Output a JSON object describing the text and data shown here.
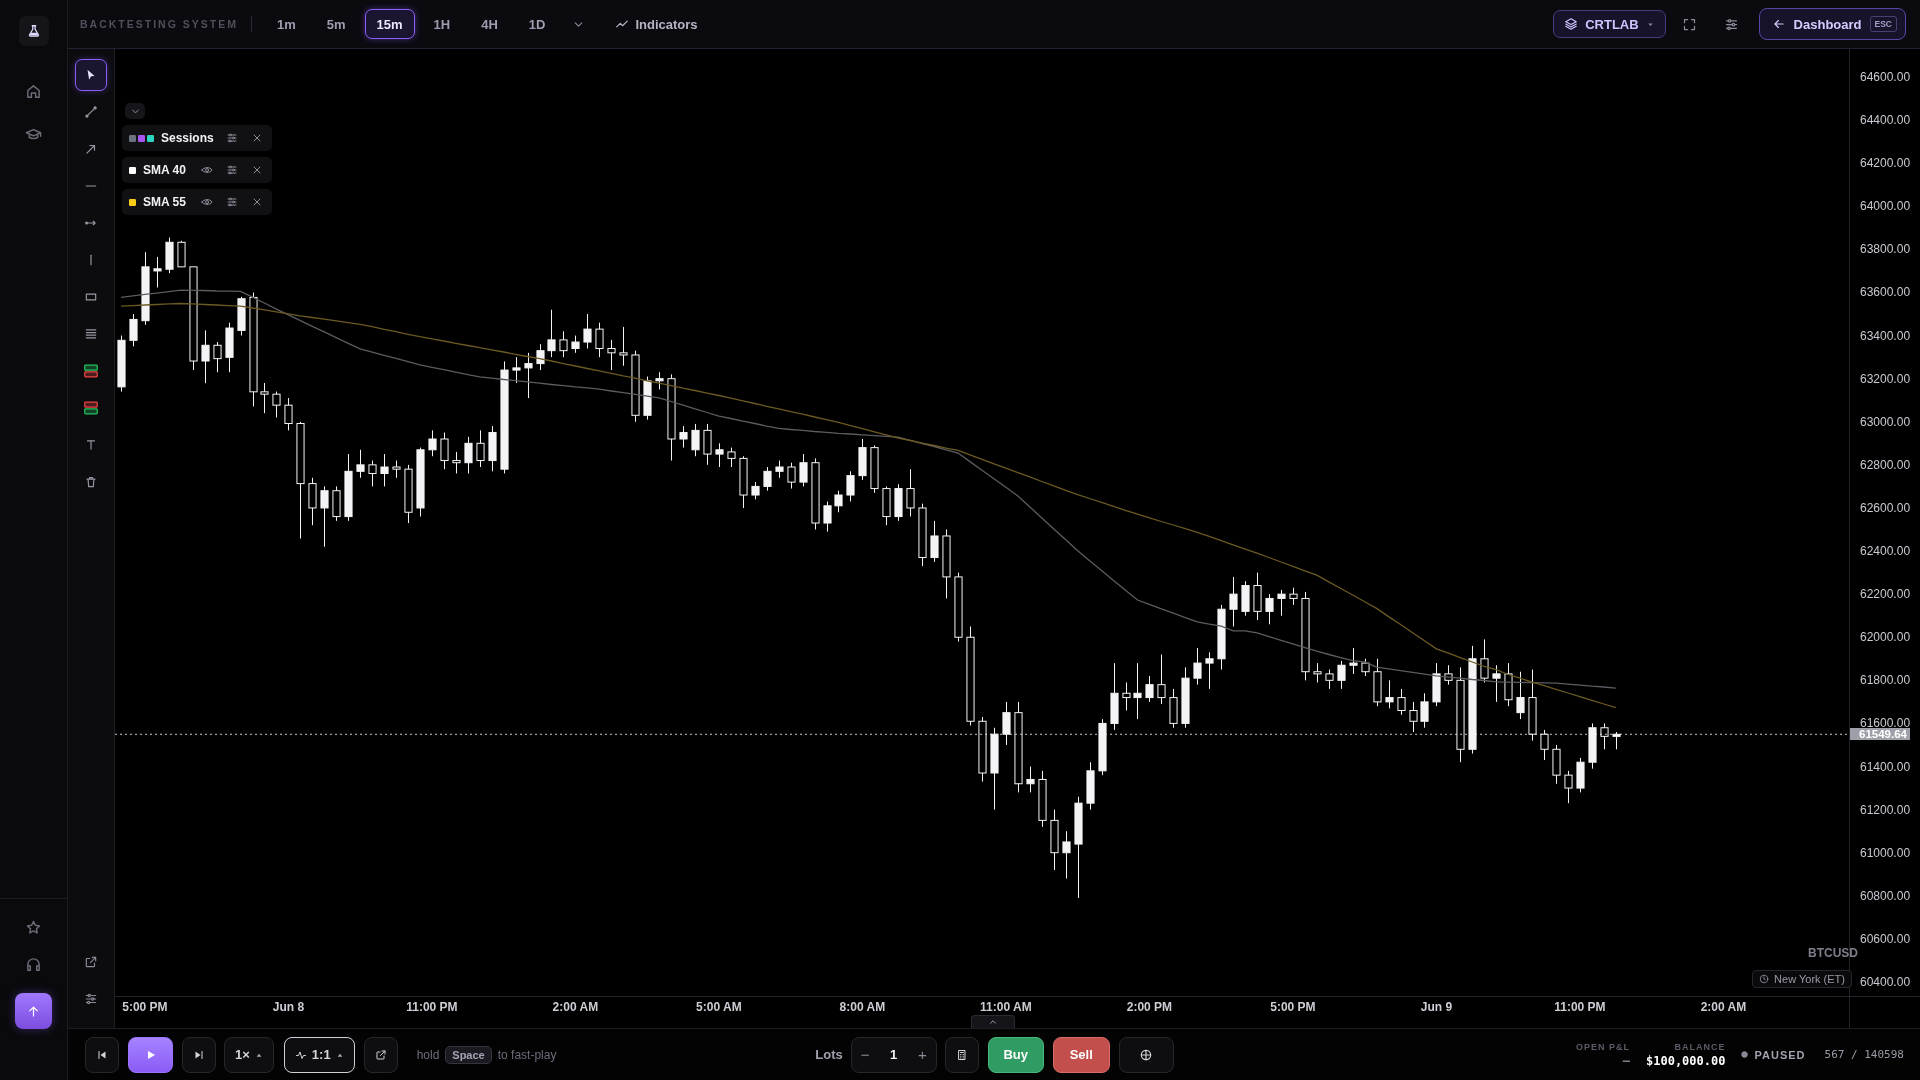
{
  "top_bar": {
    "title": "BACKTESTING SYSTEM",
    "timeframes": [
      {
        "label": "1m",
        "selected": false
      },
      {
        "label": "5m",
        "selected": false
      },
      {
        "label": "15m",
        "selected": true
      },
      {
        "label": "1H",
        "selected": false
      },
      {
        "label": "4H",
        "selected": false
      },
      {
        "label": "1D",
        "selected": false
      }
    ],
    "indicators_button": "Indicators",
    "workspace_button": "CRTLAB",
    "dashboard_button": {
      "label": "Dashboard",
      "shortcut": "ESC"
    }
  },
  "drawing_tools": [
    {
      "kind": "cursor",
      "selected": true
    },
    {
      "kind": "line",
      "selected": false
    },
    {
      "kind": "ray",
      "selected": false
    },
    {
      "kind": "hline",
      "selected": false
    },
    {
      "kind": "hray",
      "selected": false
    },
    {
      "kind": "vline",
      "selected": false
    },
    {
      "kind": "rect",
      "selected": false
    },
    {
      "kind": "fib",
      "selected": false
    },
    {
      "kind": "long",
      "selected": false
    },
    {
      "kind": "short",
      "selected": false
    },
    {
      "kind": "text",
      "selected": false
    },
    {
      "kind": "trash",
      "selected": false
    }
  ],
  "indicators": [
    {
      "kind": "sessions",
      "name": "Sessions",
      "swatches": [
        {
          "color": "#6b7280"
        },
        {
          "color": "#a855f7"
        },
        {
          "color": "#2dd4bf"
        }
      ]
    },
    {
      "kind": "sma",
      "name": "SMA 40",
      "color": "#ffffff"
    },
    {
      "kind": "sma",
      "name": "SMA 55",
      "color": "#facc15"
    }
  ],
  "chart": {
    "symbol": "BTCUSD",
    "timezone": "New York (ET)",
    "chart_data": {
      "type": "candlestick",
      "categories": [
        null,
        null,
        "5:00 PM",
        null,
        null,
        null,
        null,
        null,
        null,
        null,
        null,
        null,
        null,
        null,
        "Jun 8",
        null,
        null,
        null,
        null,
        null,
        null,
        null,
        null,
        null,
        null,
        null,
        "11:00 PM",
        null,
        null,
        null,
        null,
        null,
        null,
        null,
        null,
        null,
        null,
        null,
        "2:00 AM",
        null,
        null,
        null,
        null,
        null,
        null,
        null,
        null,
        null,
        null,
        null,
        "5:00 AM",
        null,
        null,
        null,
        null,
        null,
        null,
        null,
        null,
        null,
        null,
        null,
        "8:00 AM",
        null,
        null,
        null,
        null,
        null,
        null,
        null,
        null,
        null,
        null,
        null,
        "11:00 AM",
        null,
        null,
        null,
        null,
        null,
        null,
        null,
        null,
        null,
        null,
        null,
        "2:00 PM",
        null,
        null,
        null,
        null,
        null,
        null,
        null,
        null,
        null,
        null,
        null,
        "5:00 PM",
        null,
        null,
        null,
        null,
        null,
        null,
        null,
        null,
        null,
        null,
        null,
        "Jun 9",
        null,
        null,
        null,
        null,
        null,
        null,
        null,
        null,
        null,
        null,
        null,
        "11:00 PM",
        null,
        null,
        null,
        null,
        null,
        null,
        null,
        null,
        null,
        null,
        null,
        "2:00 AM",
        null,
        null,
        null,
        null,
        null,
        null,
        null,
        null,
        null,
        null
      ],
      "ylim": [
        60335,
        64730
      ],
      "yticks": [
        {
          "value": 60400,
          "label": "60400.00"
        },
        {
          "value": 60600,
          "label": "60600.00"
        },
        {
          "value": 60800,
          "label": "60800.00"
        },
        {
          "value": 61000,
          "label": "61000.00"
        },
        {
          "value": 61200,
          "label": "61200.00"
        },
        {
          "value": 61400,
          "label": "61400.00"
        },
        {
          "value": 61600,
          "label": "61600.00"
        },
        {
          "value": 61800,
          "label": "61800.00"
        },
        {
          "value": 62000,
          "label": "62000.00"
        },
        {
          "value": 62200,
          "label": "62200.00"
        },
        {
          "value": 62400,
          "label": "62400.00"
        },
        {
          "value": 62600,
          "label": "62600.00"
        },
        {
          "value": 62800,
          "label": "62800.00"
        },
        {
          "value": 63000,
          "label": "63000.00"
        },
        {
          "value": 63200,
          "label": "63200.00"
        },
        {
          "value": 63400,
          "label": "63400.00"
        },
        {
          "value": 63600,
          "label": "63600.00"
        },
        {
          "value": 63800,
          "label": "63800.00"
        },
        {
          "value": 64000,
          "label": "64000.00"
        },
        {
          "value": 64200,
          "label": "64200.00"
        },
        {
          "value": 64400,
          "label": "64400.00"
        },
        {
          "value": 64600,
          "label": "64600.00"
        }
      ],
      "ohlc": [
        [
          63162,
          63400,
          63140,
          63378
        ],
        [
          63378,
          63500,
          63350,
          63475
        ],
        [
          63469,
          63787,
          63450,
          63719
        ],
        [
          63700,
          63765,
          63623,
          63710
        ],
        [
          63708,
          63855,
          63690,
          63833
        ],
        [
          63833,
          63840,
          63719,
          63719
        ],
        [
          63719,
          63720,
          63240,
          63282
        ],
        [
          63282,
          63424,
          63179,
          63355
        ],
        [
          63355,
          63370,
          63230,
          63293
        ],
        [
          63299,
          63460,
          63230,
          63435
        ],
        [
          63424,
          63580,
          63400,
          63571
        ],
        [
          63577,
          63600,
          63071,
          63139
        ],
        [
          63139,
          63180,
          63040,
          63128
        ],
        [
          63128,
          63140,
          63020,
          63077
        ],
        [
          63077,
          63110,
          62960,
          62992
        ],
        [
          62992,
          63000,
          62458,
          62713
        ],
        [
          62713,
          62740,
          62520,
          62600
        ],
        [
          62600,
          62700,
          62420,
          62680
        ],
        [
          62680,
          62700,
          62540,
          62560
        ],
        [
          62560,
          62850,
          62540,
          62770
        ],
        [
          62770,
          62870,
          62740,
          62800
        ],
        [
          62800,
          62820,
          62700,
          62760
        ],
        [
          62760,
          62850,
          62700,
          62790
        ],
        [
          62790,
          62820,
          62740,
          62780
        ],
        [
          62780,
          62800,
          62530,
          62580
        ],
        [
          62600,
          62880,
          62560,
          62870
        ],
        [
          62870,
          62960,
          62840,
          62920
        ],
        [
          62920,
          62950,
          62780,
          62820
        ],
        [
          62820,
          62860,
          62760,
          62810
        ],
        [
          62810,
          62930,
          62760,
          62900
        ],
        [
          62900,
          62960,
          62790,
          62820
        ],
        [
          62820,
          62980,
          62770,
          62950
        ],
        [
          62780,
          63280,
          62760,
          63240
        ],
        [
          63240,
          63300,
          63180,
          63250
        ],
        [
          63250,
          63320,
          63110,
          63270
        ],
        [
          63270,
          63360,
          63240,
          63330
        ],
        [
          63330,
          63520,
          63300,
          63380
        ],
        [
          63380,
          63420,
          63300,
          63330
        ],
        [
          63340,
          63400,
          63320,
          63370
        ],
        [
          63370,
          63500,
          63340,
          63430
        ],
        [
          63430,
          63460,
          63300,
          63340
        ],
        [
          63340,
          63380,
          63240,
          63320
        ],
        [
          63320,
          63440,
          63260,
          63310
        ],
        [
          63310,
          63330,
          63000,
          63030
        ],
        [
          63030,
          63210,
          63010,
          63190
        ],
        [
          63190,
          63230,
          63150,
          63200
        ],
        [
          63200,
          63220,
          62820,
          62920
        ],
        [
          62920,
          62980,
          62880,
          62950
        ],
        [
          62870,
          62990,
          62840,
          62960
        ],
        [
          62960,
          62990,
          62800,
          62850
        ],
        [
          62850,
          62900,
          62790,
          62870
        ],
        [
          62860,
          62880,
          62790,
          62830
        ],
        [
          62830,
          62840,
          62600,
          62660
        ],
        [
          62660,
          62720,
          62640,
          62700
        ],
        [
          62700,
          62790,
          62680,
          62770
        ],
        [
          62770,
          62820,
          62740,
          62790
        ],
        [
          62790,
          62810,
          62690,
          62720
        ],
        [
          62720,
          62850,
          62700,
          62810
        ],
        [
          62810,
          62830,
          62500,
          62530
        ],
        [
          62530,
          62630,
          62490,
          62610
        ],
        [
          62610,
          62680,
          62580,
          62660
        ],
        [
          62660,
          62770,
          62630,
          62750
        ],
        [
          62750,
          62920,
          62730,
          62880
        ],
        [
          62880,
          62890,
          62670,
          62690
        ],
        [
          62690,
          62700,
          62520,
          62560
        ],
        [
          62560,
          62710,
          62540,
          62690
        ],
        [
          62690,
          62780,
          62560,
          62600
        ],
        [
          62600,
          62620,
          62330,
          62370
        ],
        [
          62370,
          62540,
          62350,
          62470
        ],
        [
          62470,
          62500,
          62180,
          62280
        ],
        [
          62280,
          62300,
          61980,
          62000
        ],
        [
          62000,
          62050,
          61590,
          61610
        ],
        [
          61610,
          61630,
          61330,
          61370
        ],
        [
          61370,
          61580,
          61200,
          61550
        ],
        [
          61550,
          61700,
          61500,
          61650
        ],
        [
          61650,
          61700,
          61280,
          61320
        ],
        [
          61320,
          61400,
          61280,
          61340
        ],
        [
          61340,
          61380,
          61120,
          61150
        ],
        [
          61150,
          61200,
          60920,
          61000
        ],
        [
          61000,
          61100,
          60880,
          61050
        ],
        [
          61040,
          61260,
          60790,
          61230
        ],
        [
          61230,
          61420,
          61200,
          61380
        ],
        [
          61380,
          61620,
          61360,
          61600
        ],
        [
          61600,
          61880,
          61570,
          61740
        ],
        [
          61740,
          61790,
          61660,
          61720
        ],
        [
          61720,
          61880,
          61620,
          61740
        ],
        [
          61720,
          61820,
          61700,
          61780
        ],
        [
          61780,
          61920,
          61690,
          61720
        ],
        [
          61720,
          61760,
          61580,
          61600
        ],
        [
          61600,
          61860,
          61580,
          61810
        ],
        [
          61810,
          61950,
          61780,
          61880
        ],
        [
          61880,
          61930,
          61760,
          61900
        ],
        [
          61900,
          62150,
          61850,
          62130
        ],
        [
          62130,
          62280,
          62050,
          62200
        ],
        [
          62120,
          62260,
          62100,
          62240
        ],
        [
          62240,
          62300,
          62080,
          62120
        ],
        [
          62120,
          62200,
          62060,
          62180
        ],
        [
          62180,
          62220,
          62100,
          62200
        ],
        [
          62200,
          62230,
          62150,
          62180
        ],
        [
          62180,
          62210,
          61800,
          61840
        ],
        [
          61840,
          61880,
          61790,
          61830
        ],
        [
          61830,
          61850,
          61760,
          61800
        ],
        [
          61800,
          61890,
          61760,
          61870
        ],
        [
          61870,
          61950,
          61830,
          61880
        ],
        [
          61880,
          61900,
          61820,
          61840
        ],
        [
          61840,
          61900,
          61680,
          61700
        ],
        [
          61700,
          61800,
          61670,
          61720
        ],
        [
          61720,
          61760,
          61640,
          61660
        ],
        [
          61660,
          61700,
          61560,
          61610
        ],
        [
          61610,
          61740,
          61580,
          61700
        ],
        [
          61700,
          61880,
          61680,
          61830
        ],
        [
          61830,
          61870,
          61780,
          61800
        ],
        [
          61800,
          61860,
          61420,
          61480
        ],
        [
          61480,
          61960,
          61460,
          61900
        ],
        [
          61900,
          61990,
          61790,
          61810
        ],
        [
          61810,
          61870,
          61700,
          61830
        ],
        [
          61830,
          61880,
          61680,
          61710
        ],
        [
          61650,
          61840,
          61620,
          61720
        ],
        [
          61720,
          61850,
          61520,
          61550
        ],
        [
          61550,
          61570,
          61430,
          61480
        ],
        [
          61480,
          61500,
          61320,
          61360
        ],
        [
          61360,
          61380,
          61230,
          61300
        ],
        [
          61300,
          61440,
          61280,
          61420
        ],
        [
          61420,
          61600,
          61390,
          61580
        ],
        [
          61580,
          61600,
          61480,
          61540
        ],
        [
          61540,
          61560,
          61480,
          61549.64
        ],
        null,
        null,
        null,
        null,
        null,
        null,
        null,
        null,
        null,
        null,
        null,
        null,
        null,
        null,
        null,
        null,
        null,
        null,
        null
      ],
      "series": [
        {
          "type": "line",
          "color": "#5b5b62",
          "values": [
            63577,
            63584,
            63591,
            63597,
            63604,
            63611,
            63610,
            63609,
            63607,
            63606,
            63605,
            63578,
            63551,
            63523,
            63496,
            63469,
            63443,
            63417,
            63390,
            63364,
            63338,
            63323,
            63308,
            63294,
            63279,
            63264,
            63253,
            63242,
            63230,
            63219,
            63208,
            63202,
            63196,
            63191,
            63185,
            63179,
            63173,
            63168,
            63162,
            63157,
            63151,
            63143,
            63135,
            63127,
            63119,
            63111,
            63094,
            63077,
            63060,
            63043,
            63026,
            63015,
            63003,
            62992,
            62980,
            62969,
            62964,
            62960,
            62955,
            62951,
            62946,
            62943,
            62939,
            62936,
            62932,
            62929,
            62914,
            62899,
            62885,
            62870,
            62855,
            62815,
            62775,
            62736,
            62696,
            62656,
            62605,
            62554,
            62503,
            62452,
            62401,
            62355,
            62310,
            62264,
            62218,
            62173,
            62153,
            62132,
            62112,
            62091,
            62071,
            62061,
            62051,
            62030,
            62030,
            62020,
            62003,
            61986,
            61969,
            61952,
            61935,
            61920,
            61905,
            61891,
            61885,
            61861,
            61853,
            61845,
            61837,
            61829,
            61821,
            61815,
            61810,
            61804,
            61799,
            61793,
            61792,
            61791,
            61789,
            61788,
            61787,
            61782,
            61778,
            61773,
            61769,
            61764,
            null,
            null,
            null,
            null,
            null,
            null,
            null,
            null,
            null,
            null,
            null,
            null,
            null,
            null,
            null,
            null,
            null,
            null,
            null
          ]
        },
        {
          "type": "line",
          "color": "#6b5a22",
          "values": [
            63537,
            63539,
            63542,
            63544,
            63547,
            63549,
            63547,
            63544,
            63542,
            63539,
            63537,
            63528,
            63519,
            63510,
            63501,
            63492,
            63484,
            63476,
            63468,
            63460,
            63452,
            63441,
            63429,
            63418,
            63406,
            63395,
            63385,
            63375,
            63364,
            63354,
            63344,
            63334,
            63324,
            63313,
            63303,
            63293,
            63282,
            63270,
            63259,
            63247,
            63236,
            63225,
            63213,
            63202,
            63190,
            63179,
            63168,
            63156,
            63145,
            63133,
            63122,
            63110,
            63097,
            63085,
            63072,
            63060,
            63047,
            63035,
            63022,
            63010,
            62997,
            62982,
            62968,
            62953,
            62939,
            62924,
            62913,
            62901,
            62890,
            62878,
            62867,
            62846,
            62826,
            62805,
            62785,
            62764,
            62744,
            62723,
            62703,
            62682,
            62662,
            62644,
            62626,
            62607,
            62589,
            62571,
            62554,
            62537,
            62521,
            62504,
            62487,
            62468,
            62448,
            62429,
            62409,
            62390,
            62370,
            62349,
            62329,
            62308,
            62288,
            62257,
            62226,
            62196,
            62165,
            62134,
            62096,
            62059,
            62021,
            61984,
            61946,
            61926,
            61905,
            61885,
            61864,
            61850,
            61827,
            61810,
            61792,
            61775,
            61758,
            61741,
            61724,
            61707,
            61690,
            61673,
            null,
            null,
            null,
            null,
            null,
            null,
            null,
            null,
            null,
            null,
            null,
            null,
            null,
            null,
            null,
            null,
            null,
            null,
            null
          ]
        }
      ],
      "ref_lines": [
        {
          "axis": "y",
          "value": 61549.64,
          "label": "61549.64"
        }
      ]
    }
  },
  "playback": {
    "speed": "1×",
    "ratio": "1:1",
    "hint": {
      "before": "hold",
      "key": "Space",
      "after": "to fast-play"
    }
  },
  "trade": {
    "lots_label": "Lots",
    "lots_value": "1",
    "decrement": "−",
    "increment": "+",
    "buy": "Buy",
    "sell": "Sell"
  },
  "status": {
    "open_pnl_label": "OPEN P&L",
    "open_pnl_value": "–",
    "balance_label": "BALANCE",
    "balance_value": "$100,000.00",
    "state": "PAUSED",
    "progress": "567 / 140598"
  }
}
